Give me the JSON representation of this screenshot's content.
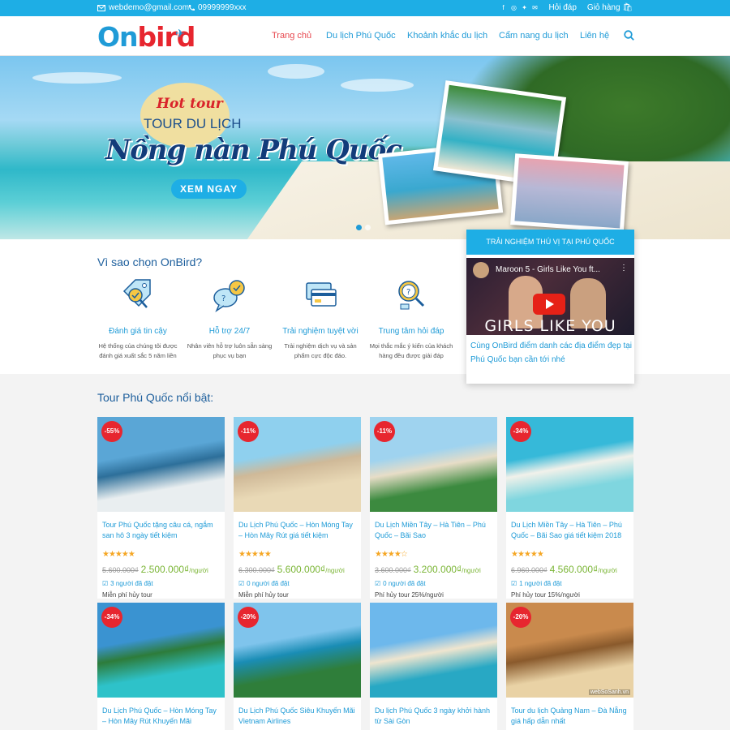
{
  "topbar": {
    "email": "webdemo@gmail.com",
    "phone": "09999999xxx",
    "social_icons": [
      "facebook-icon",
      "instagram-icon",
      "twitter-icon",
      "mail-icon"
    ],
    "faq": "Hỏi đáp",
    "cart": "Giỏ hàng"
  },
  "brand": {
    "part1": "On",
    "part2": "bird"
  },
  "nav": {
    "items": [
      "Trang chủ",
      "Du lịch Phú Quốc",
      "Khoảnh khắc du lịch",
      "Cẩm nang du lịch",
      "Liên hệ"
    ],
    "active": "Trang chủ"
  },
  "hero": {
    "hot_tour": "Hot tour",
    "tour_du_lich": "TOUR DU LỊCH",
    "headline": "Nồng nàn Phú Quốc",
    "cta": "XEM NGAY",
    "slides": 2,
    "active_slide": 1
  },
  "why": {
    "title": "Vì sao chọn OnBird?",
    "features": [
      {
        "icon": "price-tag-icon",
        "title": "Đánh giá tin cậy",
        "desc": "Hệ thống của chúng tôi được đánh giá xuất sắc 5 năm liền"
      },
      {
        "icon": "chat-support-icon",
        "title": "Hỗ trợ 24/7",
        "desc": "Nhân viên hỗ trợ luôn sẵn sàng phục vụ bạn"
      },
      {
        "icon": "credit-card-icon",
        "title": "Trải nghiệm tuyệt vời",
        "desc": "Trải nghiệm dịch vụ và sản phẩm cực độc đáo."
      },
      {
        "icon": "magnifier-question-icon",
        "title": "Trung tâm hỏi đáp",
        "desc": "Mọi thắc mắc ý kiến của khách hàng đều được giải đáp"
      }
    ]
  },
  "video_card": {
    "heading": "TRẢI NGHIỆM THÚ VỊ TẠI PHÚ QUỐC",
    "video_title": "Maroon 5 - Girls Like You ft...",
    "video_overlay": "GIRLS LIKE YOU",
    "caption": "Cùng OnBird điểm danh các địa điểm đẹp tại Phú Quốc bạn cần tới nhé"
  },
  "tours": {
    "title": "Tour Phú Quốc nổi bật:",
    "items": [
      {
        "discount": "-55%",
        "name": "Tour Phú Quốc tặng câu cá, ngắm san hô 3 ngày tiết kiệm",
        "rating": 5,
        "old_price": "5.600.000₫",
        "new_price": "2.500.000₫",
        "unit": "/người",
        "booked": "3 người đã đặt",
        "policy": "Miễn phí hủy tour",
        "colors": [
          "#5aa6d6",
          "#e9eef0",
          "#2d6f9a"
        ]
      },
      {
        "discount": "-11%",
        "name": "Du Lịch Phú Quốc – Hòn Móng Tay – Hòn Mây Rút giá tiết kiệm",
        "rating": 5,
        "old_price": "6.300.000₫",
        "new_price": "5.600.000₫",
        "unit": "/người",
        "booked": "0 người đã đặt",
        "policy": "Miễn phí hủy tour",
        "colors": [
          "#8fd0ee",
          "#e9d9b6",
          "#cfb998"
        ]
      },
      {
        "discount": "-11%",
        "name": "Du Lịch Miền Tây – Hà Tiên – Phú Quốc – Bãi Sao",
        "rating": 4,
        "old_price": "3.600.000₫",
        "new_price": "3.200.000₫",
        "unit": "/người",
        "booked": "0 người đã đặt",
        "policy": "Phí hủy tour 25%/người",
        "colors": [
          "#9fd3ef",
          "#3c8a3f",
          "#e7ddc7"
        ]
      },
      {
        "discount": "-34%",
        "name": "Du Lịch Miền Tây – Hà Tiên – Phú Quốc – Bãi Sao giá tiết kiệm 2018",
        "rating": 5,
        "old_price": "6.960.000₫",
        "new_price": "4.560.000₫",
        "unit": "/người",
        "booked": "1 người đã đặt",
        "policy": "Phí hủy tour 15%/người",
        "colors": [
          "#36b9d9",
          "#7fd6df",
          "#f1f1ea"
        ]
      },
      {
        "discount": "-34%",
        "name": "Du Lịch Phú Quốc – Hòn Móng Tay – Hòn Mây Rút Khuyến Mãi",
        "rating": 0,
        "old_price": "",
        "new_price": "",
        "unit": "",
        "booked": "",
        "policy": "",
        "colors": [
          "#3a93d1",
          "#2ec2c9",
          "#2d7c3a"
        ]
      },
      {
        "discount": "-20%",
        "name": "Du Lịch Phú Quốc Siêu Khuyến Mãi Vietnam Airlines",
        "rating": 0,
        "old_price": "",
        "new_price": "",
        "unit": "",
        "booked": "",
        "policy": "",
        "colors": [
          "#7fc4ec",
          "#2f7e3a",
          "#1a8db5"
        ]
      },
      {
        "discount": "",
        "name": "Du lịch Phú Quốc 3 ngày khởi hành từ Sài Gòn",
        "rating": 0,
        "old_price": "",
        "new_price": "",
        "unit": "",
        "booked": "",
        "policy": "",
        "colors": [
          "#6db8ec",
          "#28a8c4",
          "#efe5cf"
        ]
      },
      {
        "discount": "-20%",
        "name": "Tour du lịch Quảng Nam – Đà Nẵng giá hấp dẫn nhất",
        "rating": 0,
        "old_price": "",
        "new_price": "",
        "unit": "",
        "booked": "",
        "policy": "",
        "colors": [
          "#c98a4d",
          "#e9d2a5",
          "#8a5a2c"
        ]
      }
    ],
    "watermark": "webSoSanh.vn"
  },
  "colors": {
    "primary": "#1eaee5",
    "accent_red": "#e7262f",
    "price_green": "#7ab535",
    "star": "#f5a623"
  }
}
